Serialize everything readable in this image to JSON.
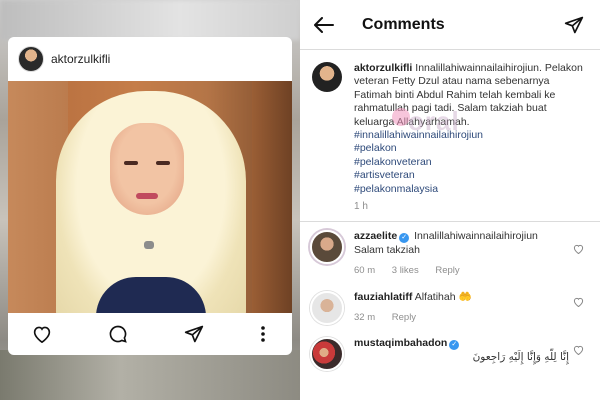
{
  "left": {
    "card": {
      "username": "aktorzulkifli",
      "actions": [
        "heart-icon",
        "comment-icon",
        "share-icon",
        "more-icon"
      ]
    }
  },
  "right": {
    "header": {
      "title": "Comments",
      "back_icon": "arrow-left-icon",
      "send_icon": "send-icon"
    },
    "caption": {
      "username": "aktorzulkifli",
      "text": "Innalillahiwainnailaihirojiun. Pelakon veteran Fetty Dzul atau nama sebenarnya Fatimah binti Abdul Rahim telah kembali ke rahmatullah pagi tadi. Salam takziah buat keluarga Allahyarhamah.",
      "hashtags": [
        "#innalillahiwainnailaihirojiun",
        "#pelakon",
        "#pelakonveteran",
        "#artisveteran",
        "#pelakonmalaysia"
      ],
      "time": "1 h",
      "watermark": "oral"
    },
    "comments": [
      {
        "username": "azzaelite",
        "verified": true,
        "text": "Innalillahiwainnailaihirojiun Salam takziah",
        "time": "60 m",
        "likes": "3 likes",
        "reply": "Reply"
      },
      {
        "username": "fauziahlatiff",
        "verified": false,
        "text": "Alfatihah 🤲",
        "time": "32 m",
        "reply": "Reply"
      },
      {
        "username": "mustaqimbahadon",
        "verified": true,
        "text": "إِنَّا لِلّهِ وَإِنَّا إِلَيْهِ رَاجِعونَ"
      }
    ]
  },
  "colors": {
    "link": "#2e4a7a",
    "muted": "#8e8e8e",
    "verified": "#3897f0"
  }
}
